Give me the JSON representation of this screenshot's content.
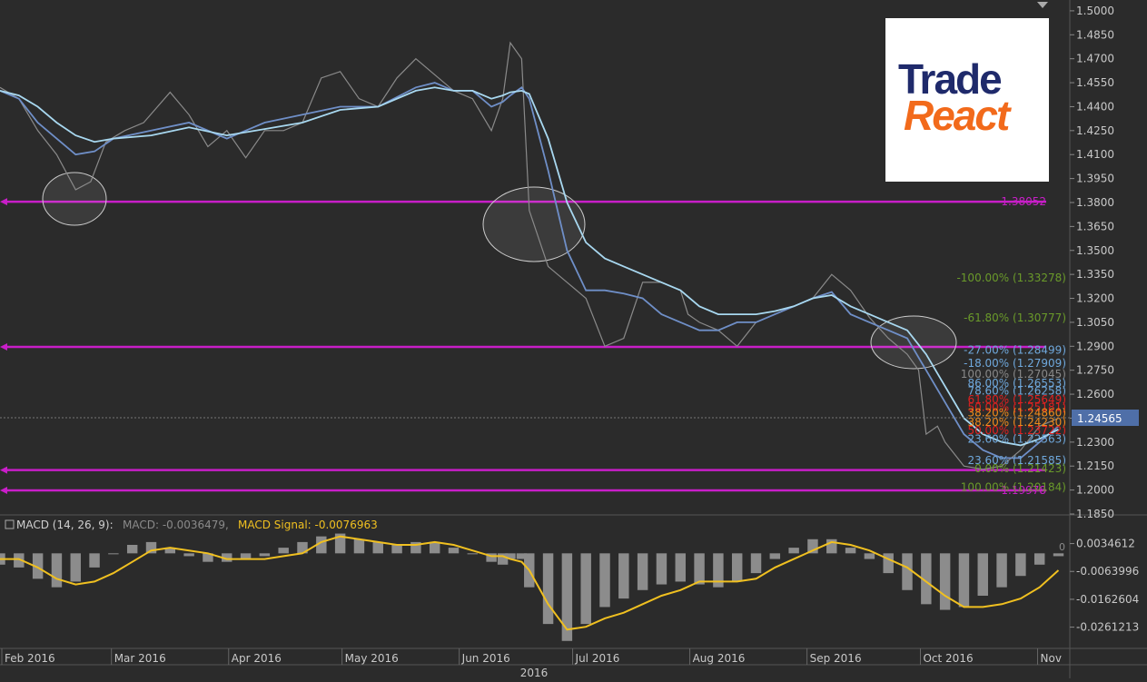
{
  "logo": {
    "line1": "Trade",
    "line2": "React"
  },
  "price_panel": {
    "last_price": "1.24565",
    "levels": [
      {
        "value": 1.38052,
        "label": "1.38052",
        "color": "#c81ec8"
      },
      {
        "value": 1.28961,
        "label": "",
        "color": "#c81ec8"
      },
      {
        "value": 1.2125,
        "label": "",
        "color": "#c81ec8"
      },
      {
        "value": 1.19978,
        "label": "1.19978",
        "color": "#c81ec8"
      }
    ],
    "fib_labels": [
      {
        "text": "-100.00% (1.33278)",
        "y": 1.33278,
        "color": "#6a9a2a"
      },
      {
        "text": "-61.80% (1.30777)",
        "y": 1.30777,
        "color": "#6a9a2a"
      },
      {
        "text": "-27.00% (1.28499)",
        "y": 1.2875,
        "color": "#6fa8dc"
      },
      {
        "text": "-18.00% (1.27909)",
        "y": 1.2795,
        "color": "#6fa8dc"
      },
      {
        "text": "100.00% (1.27045)",
        "y": 1.2725,
        "color": "#888888"
      },
      {
        "text": "86.00% (1.26553)",
        "y": 1.267,
        "color": "#6fa8dc"
      },
      {
        "text": "78.60% (1.26258)",
        "y": 1.262,
        "color": "#6fa8dc"
      },
      {
        "text": "61.80% (1.25649)",
        "y": 1.2565,
        "color": "#e02020"
      },
      {
        "text": "50.00% (1.25181)",
        "y": 1.2517,
        "color": "#e02020"
      },
      {
        "text": "38.20% (1.24860)",
        "y": 1.2485,
        "color": "#f08a1b"
      },
      {
        "text": "38.20% (1.24230)",
        "y": 1.2423,
        "color": "#f08a1b"
      },
      {
        "text": "50.00% (1.23722)",
        "y": 1.2372,
        "color": "#e02020"
      },
      {
        "text": "23.60% (1.22563)",
        "y": 1.2318,
        "color": "#6fa8dc"
      },
      {
        "text": "23.60% (1.21585)",
        "y": 1.2185,
        "color": "#6fa8dc"
      },
      {
        "text": "0.00% (1.21423)",
        "y": 1.2135,
        "color": "#6a9a2a"
      },
      {
        "text": "100.00% (1.20184)",
        "y": 1.2018,
        "color": "#6a9a2a"
      }
    ]
  },
  "macd_panel": {
    "title": "MACD (14, 26, 9):",
    "macd_label": "MACD: -0.0036479,",
    "signal_label": "MACD Signal: -0.0076963",
    "zero_marker": "0",
    "signal_color": "#f0c020"
  },
  "chart_data": {
    "type": "line",
    "title": "",
    "xlabel": "2016",
    "ylabel": "",
    "ylim": [
      1.185,
      1.5045
    ],
    "y_ticks": [
      "1.5000",
      "1.4850",
      "1.4700",
      "1.4550",
      "1.4400",
      "1.4250",
      "1.4100",
      "1.3950",
      "1.3800",
      "1.3650",
      "1.3500",
      "1.3350",
      "1.3200",
      "1.3050",
      "1.2900",
      "1.2750",
      "1.2600",
      "1.2450",
      "1.2300",
      "1.2150",
      "1.2000",
      "1.1850"
    ],
    "x_ticks": [
      "Feb 2016",
      "Mar 2016",
      "Apr 2016",
      "May 2016",
      "Jun 2016",
      "Jul 2016",
      "Aug 2016",
      "Sep 2016",
      "Oct 2016",
      "Nov"
    ],
    "x_tick_days": [
      0,
      29,
      60,
      90,
      121,
      151,
      182,
      213,
      243,
      274
    ],
    "series": [
      {
        "role": "price",
        "color": "#8a8a8a",
        "x": [
          0,
          5,
          10,
          15,
          20,
          24,
          28,
          33,
          38,
          45,
          50,
          55,
          60,
          65,
          70,
          75,
          80,
          85,
          90,
          95,
          100,
          105,
          110,
          115,
          120,
          125,
          130,
          133,
          135,
          138,
          140,
          145,
          150,
          155,
          160,
          165,
          170,
          175,
          180,
          182,
          185,
          190,
          195,
          200,
          205,
          210,
          215,
          220,
          225,
          230,
          235,
          240,
          243,
          245,
          248,
          250,
          255,
          260,
          265,
          270,
          275,
          280
        ],
        "y": [
          1.452,
          1.445,
          1.425,
          1.41,
          1.388,
          1.393,
          1.418,
          1.425,
          1.43,
          1.449,
          1.435,
          1.415,
          1.425,
          1.408,
          1.425,
          1.425,
          1.43,
          1.458,
          1.462,
          1.445,
          1.44,
          1.458,
          1.47,
          1.46,
          1.45,
          1.445,
          1.425,
          1.445,
          1.48,
          1.47,
          1.375,
          1.34,
          1.33,
          1.32,
          1.29,
          1.295,
          1.33,
          1.33,
          1.325,
          1.31,
          1.305,
          1.3,
          1.29,
          1.305,
          1.31,
          1.315,
          1.32,
          1.335,
          1.325,
          1.308,
          1.295,
          1.285,
          1.275,
          1.235,
          1.24,
          1.23,
          1.215,
          1.213,
          1.215,
          1.225,
          1.24,
          1.245
        ]
      },
      {
        "role": "ma_fast",
        "color": "#6f8fc8",
        "x": [
          0,
          5,
          10,
          15,
          20,
          25,
          30,
          40,
          50,
          60,
          70,
          80,
          90,
          100,
          110,
          115,
          120,
          125,
          130,
          133,
          135,
          138,
          140,
          145,
          150,
          155,
          160,
          165,
          170,
          175,
          180,
          185,
          190,
          195,
          200,
          205,
          210,
          215,
          220,
          225,
          230,
          235,
          240,
          245,
          250,
          255,
          260,
          265,
          270,
          275,
          280
        ],
        "y": [
          1.45,
          1.445,
          1.43,
          1.42,
          1.41,
          1.412,
          1.42,
          1.425,
          1.43,
          1.42,
          1.43,
          1.435,
          1.44,
          1.44,
          1.452,
          1.455,
          1.45,
          1.45,
          1.44,
          1.443,
          1.447,
          1.452,
          1.445,
          1.4,
          1.35,
          1.325,
          1.325,
          1.323,
          1.32,
          1.31,
          1.305,
          1.3,
          1.3,
          1.305,
          1.305,
          1.31,
          1.315,
          1.32,
          1.324,
          1.31,
          1.305,
          1.3,
          1.295,
          1.275,
          1.255,
          1.235,
          1.225,
          1.22,
          1.22,
          1.23,
          1.24
        ]
      },
      {
        "role": "ma_slow",
        "color": "#a8d8f0",
        "x": [
          0,
          5,
          10,
          15,
          20,
          25,
          30,
          40,
          50,
          60,
          70,
          80,
          90,
          100,
          110,
          115,
          120,
          125,
          130,
          133,
          135,
          138,
          140,
          145,
          150,
          155,
          160,
          165,
          170,
          175,
          180,
          185,
          190,
          195,
          200,
          205,
          210,
          215,
          220,
          225,
          230,
          235,
          240,
          245,
          250,
          255,
          260,
          265,
          270,
          275,
          280
        ],
        "y": [
          1.45,
          1.447,
          1.44,
          1.43,
          1.422,
          1.418,
          1.42,
          1.422,
          1.427,
          1.422,
          1.426,
          1.43,
          1.438,
          1.44,
          1.45,
          1.452,
          1.45,
          1.45,
          1.445,
          1.447,
          1.449,
          1.45,
          1.448,
          1.42,
          1.38,
          1.355,
          1.345,
          1.34,
          1.335,
          1.33,
          1.325,
          1.315,
          1.31,
          1.31,
          1.31,
          1.312,
          1.315,
          1.32,
          1.322,
          1.315,
          1.31,
          1.305,
          1.3,
          1.285,
          1.265,
          1.245,
          1.235,
          1.23,
          1.228,
          1.232,
          1.238
        ]
      }
    ],
    "macd": {
      "ylim": [
        -0.033,
        0.0075
      ],
      "y_ticks": [
        "0.0034612",
        "-0.0063996",
        "-0.0162604",
        "-0.0261213"
      ],
      "y_tick_values": [
        0.0034612,
        -0.0063996,
        -0.0162604,
        -0.0261213
      ],
      "x": [
        0,
        5,
        10,
        15,
        20,
        25,
        30,
        35,
        40,
        45,
        50,
        55,
        60,
        65,
        70,
        75,
        80,
        85,
        90,
        95,
        100,
        105,
        110,
        115,
        120,
        125,
        130,
        133,
        135,
        138,
        140,
        145,
        150,
        155,
        160,
        165,
        170,
        175,
        180,
        185,
        190,
        195,
        200,
        205,
        210,
        215,
        220,
        225,
        230,
        235,
        240,
        245,
        250,
        255,
        260,
        265,
        270,
        275,
        280
      ],
      "signal": [
        -0.002,
        -0.002,
        -0.005,
        -0.009,
        -0.011,
        -0.01,
        -0.007,
        -0.003,
        0.001,
        0.002,
        0.001,
        0.0,
        -0.002,
        -0.002,
        -0.002,
        -0.001,
        0.0,
        0.004,
        0.006,
        0.005,
        0.004,
        0.003,
        0.003,
        0.004,
        0.003,
        0.001,
        -0.001,
        -0.001,
        -0.002,
        -0.003,
        -0.006,
        -0.018,
        -0.027,
        -0.026,
        -0.023,
        -0.021,
        -0.018,
        -0.015,
        -0.013,
        -0.01,
        -0.01,
        -0.01,
        -0.009,
        -0.005,
        -0.002,
        0.001,
        0.004,
        0.003,
        0.001,
        -0.002,
        -0.005,
        -0.01,
        -0.015,
        -0.019,
        -0.019,
        -0.018,
        -0.016,
        -0.012,
        -0.006
      ],
      "histogram": [
        -0.004,
        -0.005,
        -0.009,
        -0.012,
        -0.01,
        -0.005,
        0.0,
        0.003,
        0.004,
        0.002,
        -0.001,
        -0.003,
        -0.003,
        -0.002,
        -0.001,
        0.002,
        0.004,
        0.006,
        0.007,
        0.005,
        0.004,
        0.003,
        0.004,
        0.004,
        0.002,
        0.0,
        -0.003,
        -0.004,
        -0.002,
        -0.002,
        -0.012,
        -0.025,
        -0.031,
        -0.025,
        -0.019,
        -0.016,
        -0.013,
        -0.011,
        -0.01,
        -0.011,
        -0.012,
        -0.01,
        -0.007,
        -0.002,
        0.002,
        0.005,
        0.005,
        0.002,
        -0.002,
        -0.007,
        -0.013,
        -0.018,
        -0.02,
        -0.019,
        -0.015,
        -0.012,
        -0.008,
        -0.004,
        -0.001
      ]
    }
  }
}
